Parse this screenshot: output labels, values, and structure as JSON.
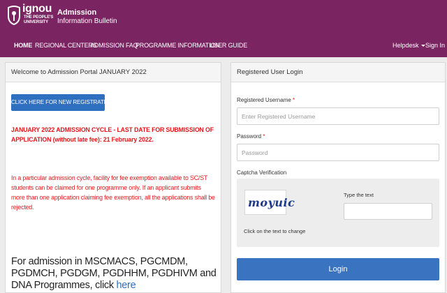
{
  "brand": {
    "logo_word": "ignou",
    "logo_sub1": "THE PEOPLE'S",
    "logo_sub2": "UNIVERSITY",
    "title": "Admission",
    "subtitle": "Information Bulletin"
  },
  "nav": {
    "items": [
      "HOME",
      "REGIONAL CENTERS",
      "ADMISSION FAQ",
      "PROGRAMME INFORMATION",
      "USER GUIDE"
    ],
    "helpdesk": "Helpdesk",
    "signin": "Sign In"
  },
  "welcome": {
    "heading": "Welcome to Admission Portal JANUARY 2022",
    "register_button": "CLICK HERE FOR NEW REGISTRATION",
    "notice_deadline": "JANUARY 2022 ADMISSION CYCLE - LAST DATE FOR SUBMISSION OF APPLICATION (without late fee): 21 February 2022.",
    "notice_fee": "In a particular admission cycle, facility for fee exemption available to SC/ST students can be claimed for one programme only. If an applicant submits more than one application claiming fee exemption, all the applications shall be rejected.",
    "admission_text": "For admission in MSCMACS, PGCMDM, PGDMCH, PGDGM, PGDHHM, PGDHIVM and DNA Programmes, click",
    "admission_link": "here"
  },
  "login": {
    "heading": "Registered User Login",
    "username_label": "Registered Username",
    "username_placeholder": "Enter Registered Username",
    "password_label": "Password",
    "password_placeholder": "Password",
    "required_mark": "*",
    "captcha_label": "Captcha Verification",
    "captcha_text": "moyuic",
    "captcha_hint": "Click on the text to change",
    "captcha_input_label": "Type the text",
    "login_button": "Login"
  },
  "colors": {
    "header": "#7b2462",
    "primary_button": "#2f6fbf",
    "notice": "#e3171b"
  }
}
